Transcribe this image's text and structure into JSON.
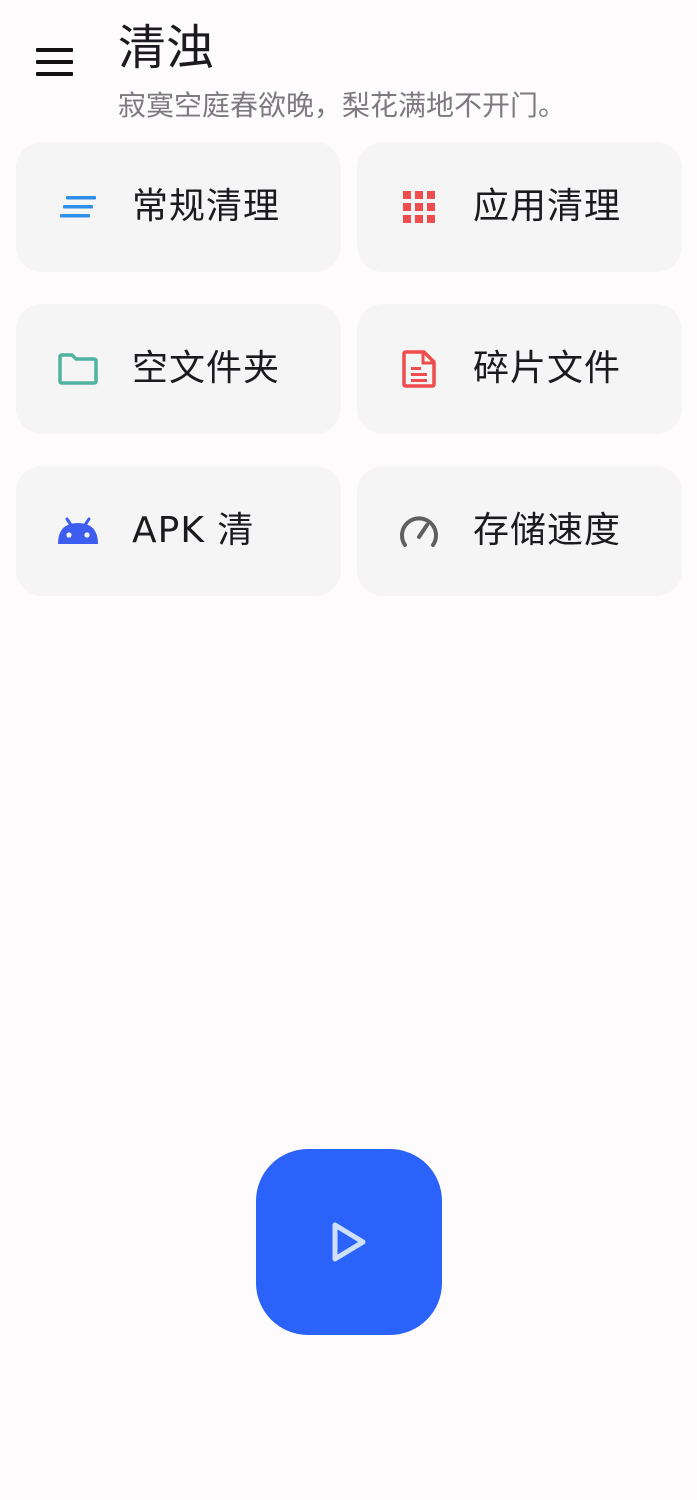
{
  "header": {
    "title": "清浊",
    "subtitle": "寂寞空庭春欲晚，梨花满地不开门。",
    "menu_icon": "menu-icon"
  },
  "tiles": [
    {
      "label": "常规清理",
      "icon": "lines-icon",
      "color": "#2f8fe8"
    },
    {
      "label": "应用清理",
      "icon": "apps-grid-icon",
      "color": "#ef4d4d"
    },
    {
      "label": "空文件夹",
      "icon": "folder-icon",
      "color": "#4fb39f"
    },
    {
      "label": "碎片文件",
      "icon": "document-icon",
      "color": "#ef4d4d"
    },
    {
      "label": "APK 清",
      "icon": "android-icon",
      "color": "#3d5cf0"
    },
    {
      "label": "存储速度",
      "icon": "speedometer-icon",
      "color": "#5f5f5f"
    }
  ],
  "fab": {
    "icon": "play-icon",
    "color": "#2b62fa",
    "icon_color": "#cfe0ff"
  }
}
